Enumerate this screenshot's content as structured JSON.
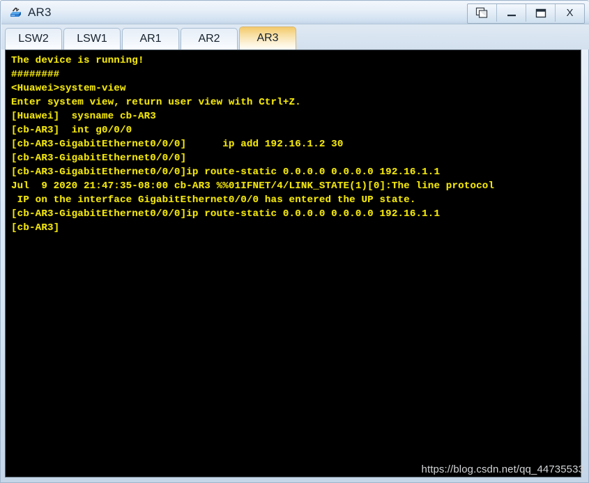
{
  "window": {
    "title": "AR3",
    "icon": "router-icon",
    "controls": [
      {
        "name": "restore-button",
        "glyph": "restore"
      },
      {
        "name": "minimize-button",
        "glyph": "_"
      },
      {
        "name": "maximize-button",
        "glyph": "maximize"
      },
      {
        "name": "close-button",
        "glyph": "X"
      }
    ]
  },
  "tabs": {
    "items": [
      {
        "label": "LSW2",
        "active": false
      },
      {
        "label": "LSW1",
        "active": false
      },
      {
        "label": "AR1",
        "active": false
      },
      {
        "label": "AR2",
        "active": false
      },
      {
        "label": "AR3",
        "active": true
      }
    ],
    "active_label": "AR3"
  },
  "terminal": {
    "foreground_color": "#f2e70b",
    "background_color": "#000000",
    "lines": [
      "The device is running!",
      "########",
      "<Huawei>system-view",
      "Enter system view, return user view with Ctrl+Z.",
      "[Huawei]  sysname cb-AR3",
      "[cb-AR3]  int g0/0/0",
      "[cb-AR3-GigabitEthernet0/0/0]      ip add 192.16.1.2 30",
      "[cb-AR3-GigabitEthernet0/0/0]",
      "[cb-AR3-GigabitEthernet0/0/0]ip route-static 0.0.0.0 0.0.0.0 192.16.1.1",
      "Jul  9 2020 21:47:35-08:00 cb-AR3 %%01IFNET/4/LINK_STATE(1)[0]:The line protocol",
      " IP on the interface GigabitEthernet0/0/0 has entered the UP state.",
      "[cb-AR3-GigabitEthernet0/0/0]ip route-static 0.0.0.0 0.0.0.0 192.16.1.1",
      "[cb-AR3]"
    ]
  },
  "watermark": {
    "text": "https://blog.csdn.net/qq_44735533"
  }
}
